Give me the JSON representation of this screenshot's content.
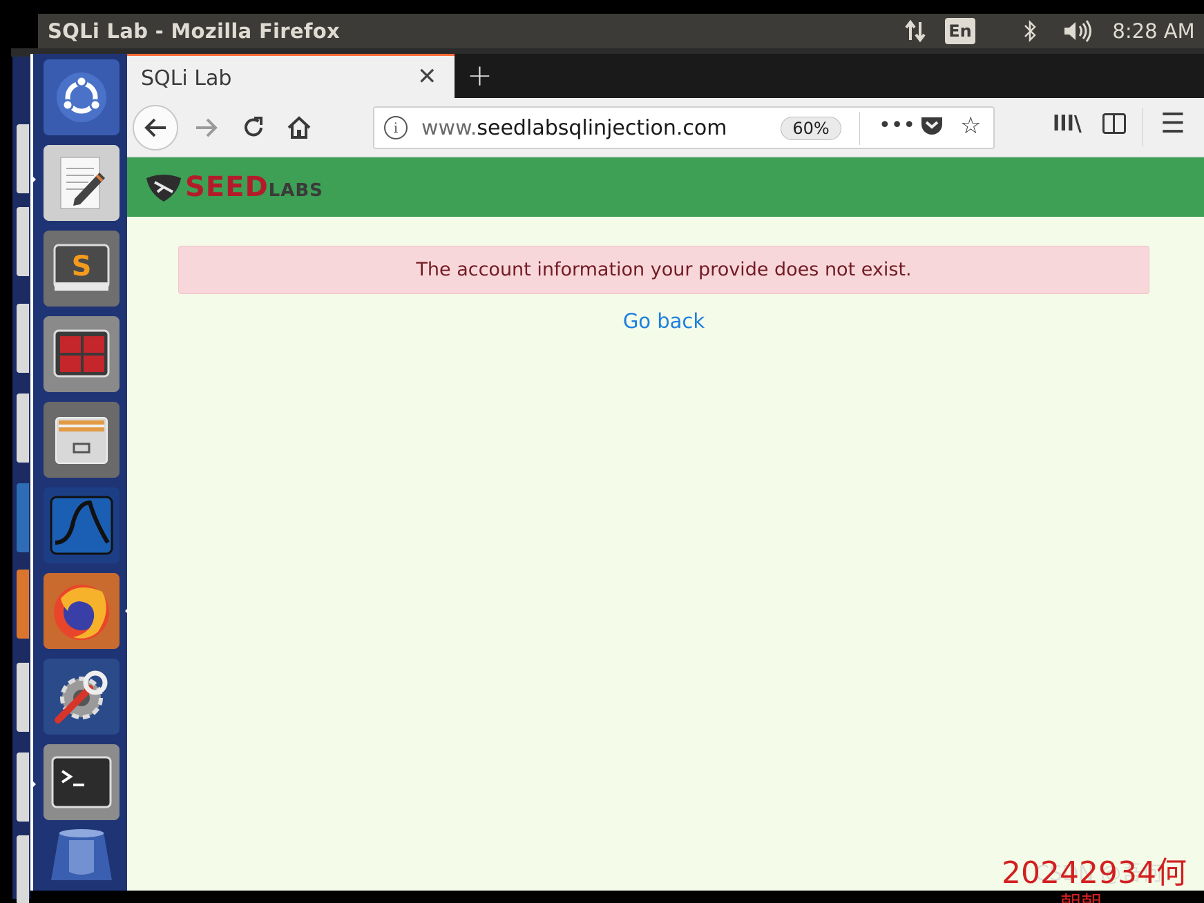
{
  "top_panel": {
    "window_title": "SQLi Lab - Mozilla Firefox",
    "keyboard_layout": "En",
    "clock": "8:28 AM",
    "icons": [
      "network-transfer-icon",
      "keyboard-layout-indicator",
      "bluetooth-icon",
      "volume-icon",
      "system-gear-icon"
    ]
  },
  "launcher": {
    "items": [
      {
        "name": "ubuntu-dash",
        "icon": "ubuntu-logo-icon"
      },
      {
        "name": "text-editor",
        "icon": "text-editor-icon"
      },
      {
        "name": "sublime-text",
        "icon": "sublime-icon"
      },
      {
        "name": "terminator",
        "icon": "terminator-icon"
      },
      {
        "name": "files",
        "icon": "file-cabinet-icon"
      },
      {
        "name": "wireshark",
        "icon": "wireshark-fin-icon"
      },
      {
        "name": "firefox",
        "icon": "firefox-icon"
      },
      {
        "name": "system-settings",
        "icon": "settings-wrench-icon"
      },
      {
        "name": "terminal",
        "icon": "terminal-icon"
      },
      {
        "name": "trash",
        "icon": "trash-icon"
      }
    ]
  },
  "browser": {
    "tab_title": "SQLi Lab",
    "close_glyph": "✕",
    "new_tab_glyph": "+",
    "url_prefix": "www.",
    "url_domain": "seedlabsqlinjection.com",
    "url_suffix": "/",
    "zoom": "60%",
    "page_actions_glyph": "•••",
    "bookmark_glyph": "☆",
    "library_glyph": "lll\\",
    "menu_glyph": "☰"
  },
  "page": {
    "logo_seed": "SEED",
    "logo_labs": "LABS",
    "alert_message": "The account information your provide does not exist.",
    "go_back": "Go back"
  },
  "watermark": {
    "text": "20242934何",
    "faint_text": "CSDN @吾何",
    "line2": "朝朝"
  },
  "colors": {
    "panel": "#3c3b37",
    "launcher": "#1f3475",
    "header_green": "#3ea055",
    "page_bg": "#f4fbe8",
    "alert_bg": "#f8d7da",
    "alert_text": "#721c24",
    "link": "#1c7fe0",
    "watermark": "#d22020"
  }
}
